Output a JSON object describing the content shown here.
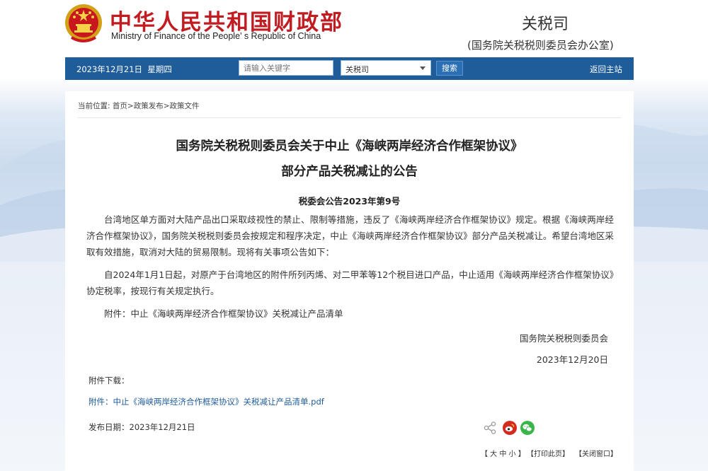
{
  "header": {
    "site_title": "中华人民共和国财政部",
    "site_subtitle": "Ministry of Finance of the People’ s Republic of China",
    "department": "关税司",
    "department_sub": "(国务院关税税则委员会办公室)"
  },
  "navbar": {
    "date": "2023年12月21日",
    "weekday": "星期四",
    "search_placeholder": "请输入关键字",
    "search_scope": "关税司",
    "search_button": "搜索",
    "home_link": "返回主站"
  },
  "breadcrumb": {
    "prefix": "当前位置:",
    "items": [
      "首页",
      "政策发布",
      "政策文件"
    ],
    "separator": ">"
  },
  "article": {
    "title_line1": "国务院关税税则委员会关于中止《海峡两岸经济合作框架协议》",
    "title_line2": "部分产品关税减让的公告",
    "doc_number": "税委会公告2023年第9号",
    "paragraph1": "台湾地区单方面对大陆产品出口采取歧视性的禁止、限制等措施，违反了《海峡两岸经济合作框架协议》规定。根据《海峡两岸经济合作框架协议》，国务院关税税则委员会按规定和程序决定，中止《海峡两岸经济合作框架协议》部分产品关税减让。希望台湾地区采取有效措施，取消对大陆的贸易限制。现将有关事项公告如下：",
    "paragraph2": "自2024年1月1日起，对原产于台湾地区的附件所列丙烯、对二甲苯等12个税目进口产品，中止适用《海峡两岸经济合作框架协议》协定税率，按现行有关规定执行。",
    "paragraph3": "附件：中止《海峡两岸经济合作框架协议》关税减让产品清单",
    "signature_org": "国务院关税税则委员会",
    "signature_date": "2023年12月20日"
  },
  "downloads": {
    "label": "附件下载：",
    "items": [
      {
        "label": "附件：中止《海峡两岸经济合作框架协议》关税减让产品清单.pdf"
      }
    ]
  },
  "publish": {
    "label": "发布日期：",
    "date": "2023年12月21日"
  },
  "share": {
    "icons": [
      "share-icon",
      "weibo-icon",
      "wechat-icon"
    ],
    "colors": {
      "weibo": "#d52b1e",
      "wechat": "#3ab54a"
    }
  },
  "tools": {
    "font_size": "【 大 中 小 】",
    "print": "【打印此页】",
    "close": "【关闭窗口】"
  },
  "colors": {
    "brand_red": "#c01c21",
    "nav_blue": "#1f5c9a",
    "link_blue": "#1f5c9a"
  }
}
